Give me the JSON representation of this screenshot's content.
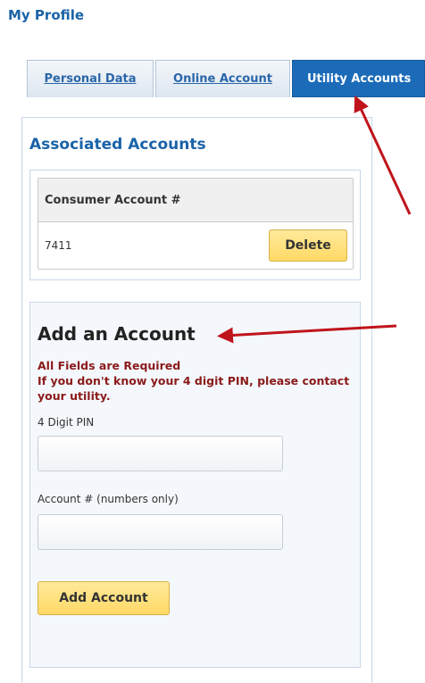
{
  "page": {
    "title": "My Profile"
  },
  "tabs": [
    {
      "label": "Personal Data",
      "active": false
    },
    {
      "label": "Online Account",
      "active": false
    },
    {
      "label": "Utility Accounts",
      "active": true
    }
  ],
  "associated": {
    "title": "Associated Accounts",
    "header": "Consumer Account #",
    "rows": [
      {
        "account": "7411",
        "action_label": "Delete"
      }
    ]
  },
  "add_account": {
    "title": "Add an Account",
    "required_note": "All Fields are Required",
    "pin_note": "If you don't know your 4 digit PIN, please contact your utility.",
    "pin_label": "4 Digit PIN",
    "pin_value": "",
    "account_label": "Account # (numbers only)",
    "account_value": "",
    "submit_label": "Add Account"
  },
  "colors": {
    "brand_blue": "#1b6bb8",
    "button_yellow": "#ffd966",
    "warning_red": "#8b1a1a",
    "annotation_arrow": "#c0141c"
  },
  "annotations": [
    {
      "name": "arrow-to-utility-tab"
    },
    {
      "name": "arrow-to-add-account"
    }
  ]
}
